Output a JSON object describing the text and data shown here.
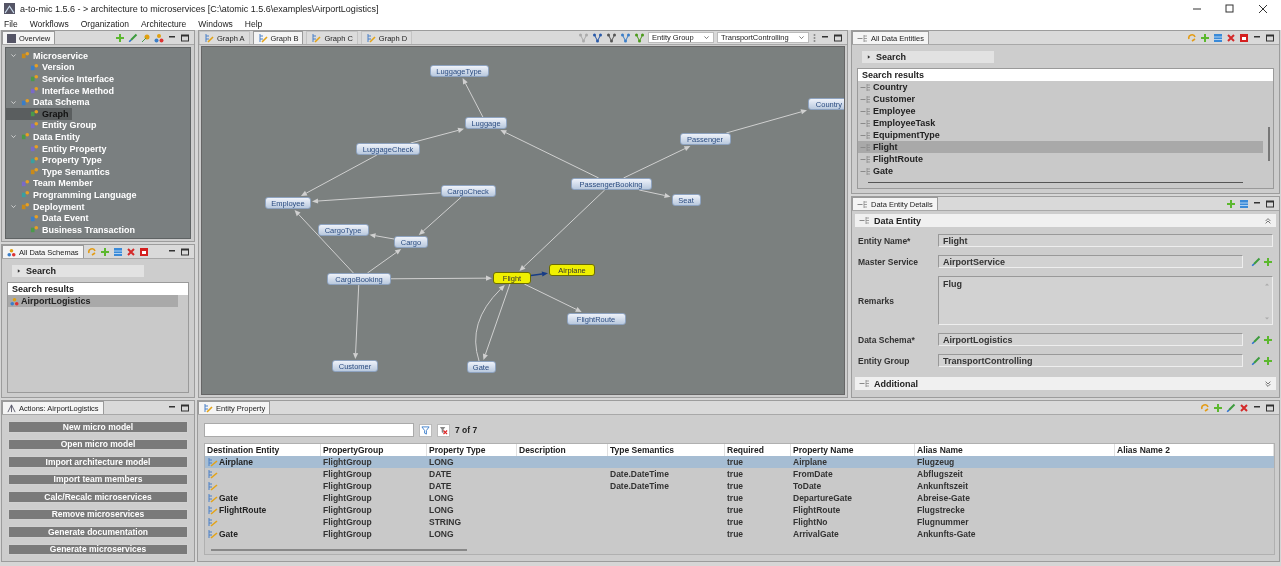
{
  "window": {
    "title": "a-to-mic 1.5.6  - >  architecture to microservices   [C:\\atomic 1.5.6\\examples\\AirportLogistics]"
  },
  "menu": [
    "File",
    "Workflows",
    "Organization",
    "Architecture",
    "Windows",
    "Help"
  ],
  "overview": {
    "tab": "Overview",
    "tree": [
      {
        "label": "Microservice",
        "expanded": true,
        "selected": false,
        "children": [
          {
            "label": "Version",
            "selected": false
          },
          {
            "label": "Service Interface",
            "selected": false
          },
          {
            "label": "Interface Method",
            "selected": false
          }
        ]
      },
      {
        "label": "Data Schema",
        "expanded": true,
        "selected": false,
        "children": [
          {
            "label": "Graph",
            "selected": true
          },
          {
            "label": "Entity Group",
            "selected": false
          }
        ]
      },
      {
        "label": "Data Entity",
        "expanded": true,
        "selected": false,
        "children": [
          {
            "label": "Entity Property",
            "selected": false
          },
          {
            "label": "Property Type",
            "selected": false
          },
          {
            "label": "Type Semantics",
            "selected": false
          }
        ]
      },
      {
        "label": "Team Member",
        "selected": false
      },
      {
        "label": "Programming Language",
        "selected": false
      },
      {
        "label": "Deployment",
        "expanded": true,
        "selected": false,
        "children": [
          {
            "label": "Data Event",
            "selected": false
          },
          {
            "label": "Business Transaction",
            "selected": false
          }
        ]
      }
    ]
  },
  "schemas": {
    "tab": "All Data Schemas",
    "search": "Search",
    "results_header": "Search results",
    "items": [
      {
        "label": "AirportLogistics",
        "selected": true
      }
    ]
  },
  "actions": {
    "tab": "Actions:  AirportLogistics",
    "buttons": [
      "New micro model",
      "Open micro model",
      "Import architecture model",
      "Import team members",
      "Calc/Recalc microservices",
      "Remove microservices",
      "Generate documentation",
      "Generate microservices"
    ]
  },
  "graph": {
    "tabs": [
      {
        "label": "Graph A",
        "selected": false
      },
      {
        "label": "Graph B",
        "selected": true
      },
      {
        "label": "Graph C",
        "selected": false
      },
      {
        "label": "Graph D",
        "selected": false
      }
    ],
    "group_select": "Entity Group",
    "value_select": "TransportControlling",
    "nodes": [
      {
        "label": "LuggageType",
        "highlighted": false
      },
      {
        "label": "Luggage",
        "highlighted": false
      },
      {
        "label": "Country",
        "highlighted": false
      },
      {
        "label": "Passenger",
        "highlighted": false
      },
      {
        "label": "LuggageCheck",
        "highlighted": false
      },
      {
        "label": "CargoCheck",
        "highlighted": false
      },
      {
        "label": "PassengerBooking",
        "highlighted": false
      },
      {
        "label": "Seat",
        "highlighted": false
      },
      {
        "label": "Employee",
        "highlighted": false
      },
      {
        "label": "CargoType",
        "highlighted": false
      },
      {
        "label": "Cargo",
        "highlighted": false
      },
      {
        "label": "CargoBooking",
        "highlighted": false
      },
      {
        "label": "Flight",
        "highlighted": true
      },
      {
        "label": "Airplane",
        "highlighted": true
      },
      {
        "label": "FlightRoute",
        "highlighted": false
      },
      {
        "label": "Customer",
        "highlighted": false
      },
      {
        "label": "Gate",
        "highlighted": false
      }
    ]
  },
  "entities": {
    "tab": "All Data Entities",
    "search": "Search",
    "results_header": "Search results",
    "items": [
      {
        "label": "Country",
        "selected": false
      },
      {
        "label": "Customer",
        "selected": false
      },
      {
        "label": "Employee",
        "selected": false
      },
      {
        "label": "EmployeeTask",
        "selected": false
      },
      {
        "label": "EquipmentType",
        "selected": false
      },
      {
        "label": "Flight",
        "selected": true
      },
      {
        "label": "FlightRoute",
        "selected": false
      },
      {
        "label": "Gate",
        "selected": false
      }
    ]
  },
  "details": {
    "tab": "Data Entity Details",
    "section": "Data Entity",
    "fields": [
      {
        "label": "Entity Name*",
        "value": "Flight",
        "kind": "text"
      },
      {
        "label": "Master Service",
        "value": "AirportService",
        "kind": "link"
      },
      {
        "label": "Remarks",
        "value": "Flug",
        "kind": "area"
      },
      {
        "label": "Data Schema*",
        "value": "AirportLogistics",
        "kind": "link"
      },
      {
        "label": "Entity Group",
        "value": "TransportControlling",
        "kind": "link"
      }
    ],
    "additional": "Additional"
  },
  "properties": {
    "tab": "Entity Property",
    "count": "7 of 7",
    "columns": [
      "Destination Entity",
      "PropertyGroup",
      "Property Type",
      "Description",
      "Type Semantics",
      "Required",
      "Property Name",
      "Alias Name",
      "Alias Name 2"
    ],
    "rows": [
      {
        "destination": "Airplane",
        "group": "FlightGroup",
        "type": "LONG",
        "required": "true",
        "name": "Airplane",
        "alias": "Flugzeug",
        "selected": true
      },
      {
        "group": "FlightGroup",
        "type": "DATE",
        "semantics": "Date.DateTime",
        "required": "true",
        "name": "FromDate",
        "alias": "Abflugszeit",
        "selected": false
      },
      {
        "group": "FlightGroup",
        "type": "DATE",
        "semantics": "Date.DateTime",
        "required": "true",
        "name": "ToDate",
        "alias": "Ankunftszeit",
        "selected": false
      },
      {
        "destination": "Gate",
        "group": "FlightGroup",
        "type": "LONG",
        "required": "true",
        "name": "DepartureGate",
        "alias": "Abreise-Gate",
        "selected": false
      },
      {
        "destination": "FlightRoute",
        "group": "FlightGroup",
        "type": "LONG",
        "required": "true",
        "name": "FlightRoute",
        "alias": "Flugstrecke",
        "selected": false
      },
      {
        "group": "FlightGroup",
        "type": "STRING",
        "required": "true",
        "name": "FlightNo",
        "alias": "Flugnummer",
        "selected": false
      },
      {
        "destination": "Gate",
        "group": "FlightGroup",
        "type": "LONG",
        "required": "true",
        "name": "ArrivalGate",
        "alias": "Ankunfts-Gate",
        "selected": false
      }
    ]
  }
}
